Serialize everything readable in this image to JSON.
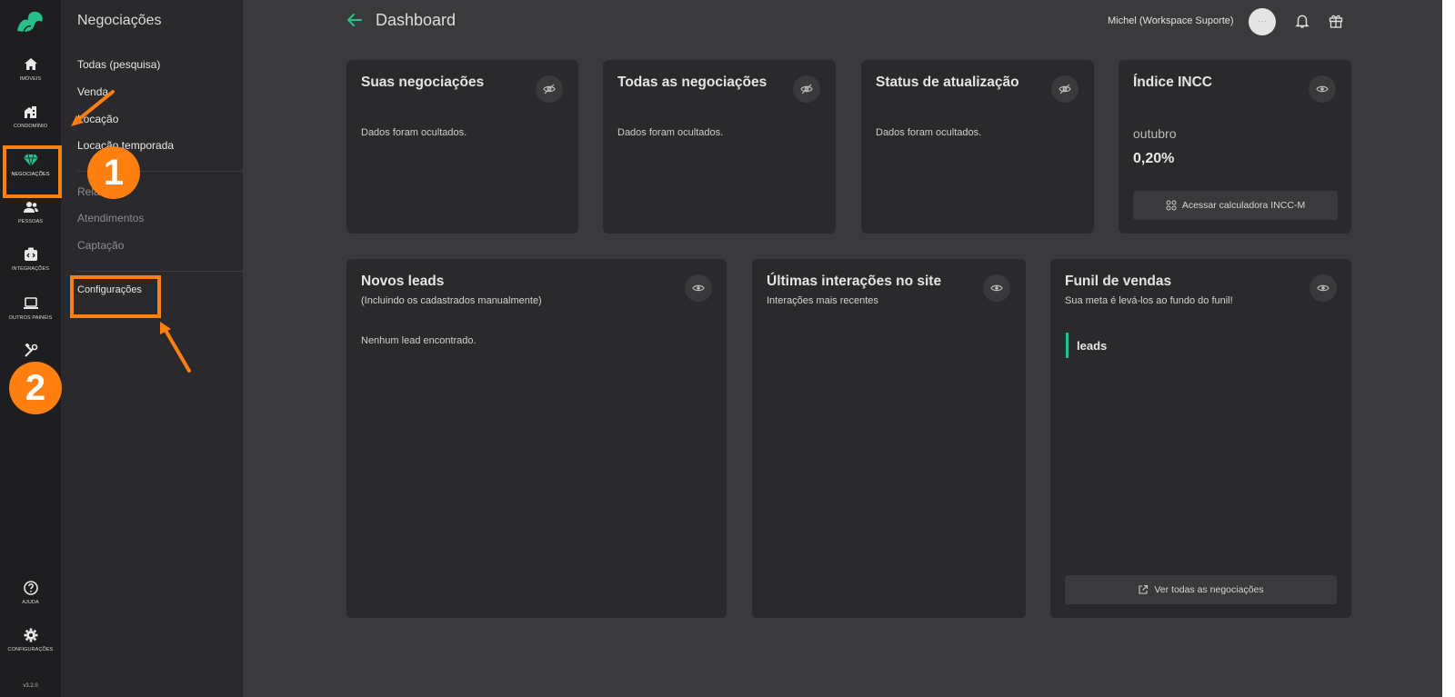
{
  "rail": {
    "items": [
      {
        "label": "IMÓVEIS",
        "icon": "home-icon"
      },
      {
        "label": "CONDOMÍNIO",
        "icon": "building-icon"
      },
      {
        "label": "NEGOCIAÇÕES",
        "icon": "diamond-icon"
      },
      {
        "label": "PESSOAS",
        "icon": "users-icon"
      },
      {
        "label": "INTEGRAÇÕES",
        "icon": "integration-icon"
      },
      {
        "label": "OUTROS PAINÉIS",
        "icon": "laptop-icon"
      },
      {
        "label": "",
        "icon": "tools-icon"
      }
    ],
    "bottom": [
      {
        "label": "AJUDA",
        "icon": "help-icon"
      },
      {
        "label": "CONFIGURAÇÕES",
        "icon": "gear-icon"
      }
    ],
    "version": "v3.2.0"
  },
  "subnav": {
    "title": "Negociações",
    "items": [
      "Todas (pesquisa)",
      "Venda",
      "Locação",
      "Locação temporada"
    ],
    "items2": [
      "Relatórios",
      "Atendimentos",
      "Captação"
    ],
    "settings": "Configurações"
  },
  "header": {
    "title": "Dashboard",
    "user": "Michel (Workspace Suporte)",
    "avatar_text": "···"
  },
  "cards": {
    "suas": {
      "title": "Suas negociações",
      "body": "Dados foram ocultados."
    },
    "todas": {
      "title": "Todas as negociações",
      "body": "Dados foram ocultados."
    },
    "status": {
      "title": "Status de atualização",
      "body": "Dados foram ocultados."
    },
    "incc": {
      "title": "Índice INCC",
      "month": "outubro",
      "value": "0,20%",
      "button": "Acessar calculadora INCC-M"
    },
    "leads": {
      "title": "Novos leads",
      "subtitle": "(Incluindo os cadastrados manualmente)",
      "body": "Nenhum lead encontrado."
    },
    "interacoes": {
      "title": "Últimas interações no site",
      "subtitle": "Interações mais recentes"
    },
    "funil": {
      "title": "Funil de vendas",
      "subtitle": "Sua meta é levá-los ao fundo do funil!",
      "stage": "leads",
      "button": "Ver todas as negociações"
    }
  },
  "annotations": {
    "badge1": "1",
    "badge2": "2"
  },
  "colors": {
    "accent": "#27c08a",
    "annotation": "#ff7f11"
  }
}
